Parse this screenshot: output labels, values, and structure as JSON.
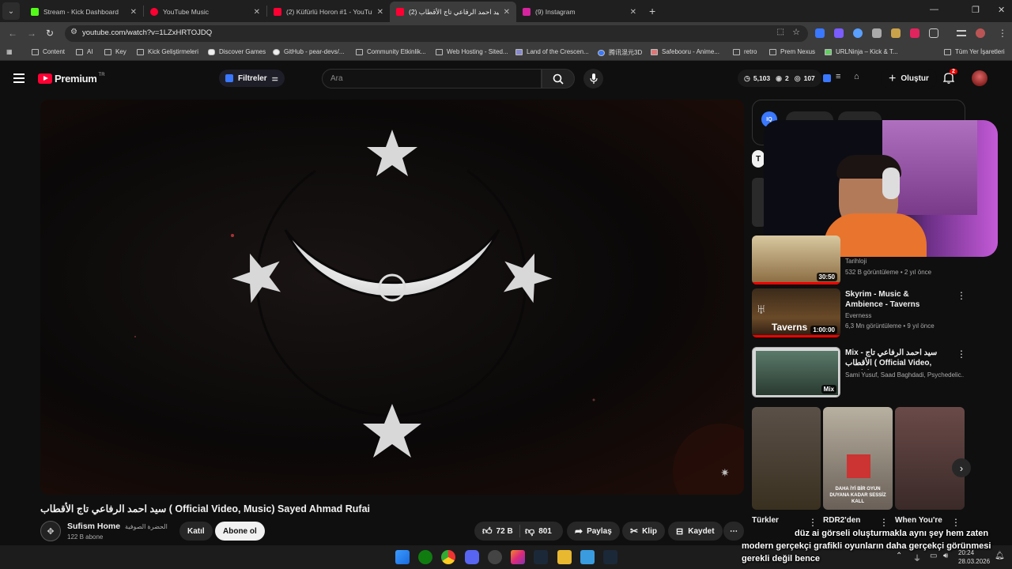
{
  "tabs": [
    {
      "title": "Stream - Kick Dashboard",
      "color": "#53fc18"
    },
    {
      "title": "YouTube Music",
      "color": "#ff0033"
    },
    {
      "title": "(2) Küfürlü Horon #1 - YouTube",
      "color": "#ff0033"
    },
    {
      "title": "سيد احمد الرفاعي تاج الأقطاب (2)",
      "color": "#ff0033"
    },
    {
      "title": "(9) Instagram",
      "color": "#d6249f"
    }
  ],
  "address": {
    "url": "youtube.com/watch?v=1LZxHRTOJDQ"
  },
  "bookmarks": [
    {
      "label": "Content"
    },
    {
      "label": "AI"
    },
    {
      "label": "Key"
    },
    {
      "label": "Kick Geliştirmeleri"
    },
    {
      "label": "Discover Games"
    },
    {
      "label": "GitHub - pear-devs/..."
    },
    {
      "label": "Community Etkinlik..."
    },
    {
      "label": "Web Hosting - Sited..."
    },
    {
      "label": "Land of the Crescen..."
    },
    {
      "label": "腾讯混元3D"
    },
    {
      "label": "Safebooru - Anime..."
    },
    {
      "label": "retro"
    },
    {
      "label": "Prem Nexus"
    },
    {
      "label": "URLNinja – Kick & T..."
    },
    {
      "label": "Tüm Yer İşaretleri"
    }
  ],
  "header": {
    "logo": "Premium",
    "region": "TR",
    "filters_label": "Filtreler",
    "search_placeholder": "Ara",
    "stats": {
      "views": "5,103",
      "count2": "2",
      "count3": "107"
    },
    "create_label": "Oluştur",
    "notif_count": "2"
  },
  "video": {
    "title": "سيد احمد الرفاعي تاج الأقطاب ( Official Video, Music) Sayed Ahmad Rufai",
    "channel": "Sufism Home",
    "channel_arabic": "الحضرة الصوفية",
    "subscribers": "122 B abone",
    "join_label": "Katıl",
    "subscribe_label": "Abone ol",
    "likes": "72 B",
    "dislikes": "801",
    "share_label": "Paylaş",
    "clip_label": "Klip",
    "save_label": "Kaydet"
  },
  "sidebar": {
    "chip_first": "T",
    "items": [
      {
        "title": "",
        "channel": "Tarihloji",
        "meta": "532 B görüntüleme • 2 yıl önce",
        "duration": "30:50"
      },
      {
        "title": "Skyrim - Music & Ambience - Taverns",
        "channel": "Everness",
        "meta": "6,3 Mn görüntüleme • 9 yıl önce",
        "duration": "1:00:00",
        "thumb_text": "Taverns"
      },
      {
        "title": "Mix - سيد احمد الرفاعي تاج الأقطاب ( Official Video, Music) Saye...",
        "channel": "Sami Yusuf, Saad Baghdadi, Psychedelic...",
        "meta": "",
        "duration": "Mix"
      }
    ],
    "shorts": [
      {
        "title": "Türkler"
      },
      {
        "title": "RDR2'den",
        "overlay": "DAHA İYİ BİR OYUN DUYANA KADAR SESSİZ KALL"
      },
      {
        "title": "When You're"
      }
    ]
  },
  "caption": {
    "line1": "düz ai görseli oluşturmakla aynı şey hem zaten",
    "line2": "modern gerçekçi grafikli oyunların daha gerçekçi görünmesi",
    "line3": "gerekli değil bence"
  },
  "taskbar": {
    "time": "20:24",
    "date": "28.03.2026"
  }
}
